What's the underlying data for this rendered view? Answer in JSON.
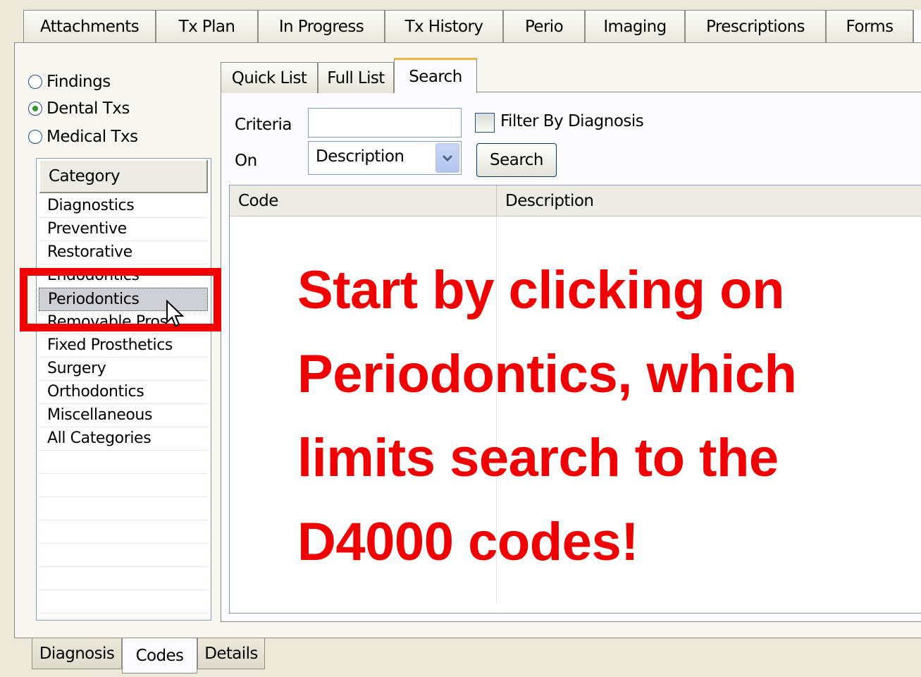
{
  "top_tabs": [
    "Attachments",
    "Tx Plan",
    "In Progress",
    "Tx History",
    "Perio",
    "Imaging",
    "Prescriptions",
    "Forms"
  ],
  "filters": {
    "findings": "Findings",
    "dental": "Dental Txs",
    "medical": "Medical Txs",
    "selected": "Dental Txs"
  },
  "category": {
    "header": "Category",
    "items": [
      "Diagnostics",
      "Preventive",
      "Restorative",
      "Endodontics",
      "Periodontics",
      "Removable Pros",
      "Fixed Prosthetics",
      "Surgery",
      "Orthodontics",
      "Miscellaneous",
      "All Categories"
    ],
    "selected": "Periodontics"
  },
  "search_tabs": [
    "Quick List",
    "Full List",
    "Search"
  ],
  "search_tabs_active": "Search",
  "search": {
    "criteria_label": "Criteria",
    "criteria_value": "",
    "filter_label": "Filter By Diagnosis",
    "on_label": "On",
    "on_value": "Description",
    "button": "Search"
  },
  "results": {
    "columns": [
      "Code",
      "Description"
    ],
    "rows": []
  },
  "annotation": "Start by clicking on Periodontics, which limits search to the D4000 codes!",
  "bottom_tabs": [
    "Diagnosis",
    "Codes",
    "Details"
  ],
  "bottom_tabs_active": "Codes",
  "colors": {
    "annotation": "#f00000",
    "tab_highlight": "#f2b43c"
  }
}
